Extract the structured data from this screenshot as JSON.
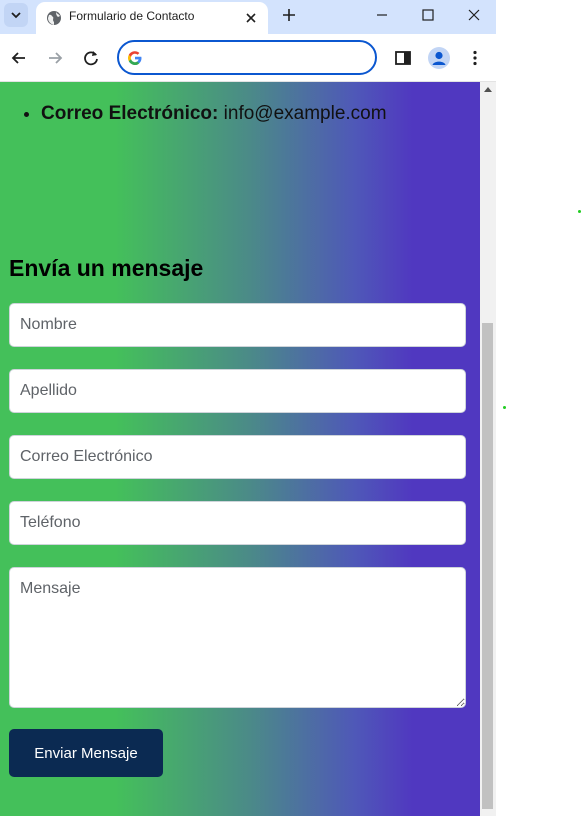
{
  "tab": {
    "title": "Formulario de Contacto",
    "favicon": "globe-icon"
  },
  "toolbar": {
    "address_value": "",
    "search_engine_icon": "google-icon"
  },
  "contact": {
    "email_label": "Correo Electrónico:",
    "email_value": "info@example.com"
  },
  "form": {
    "title": "Envía un mensaje",
    "fields": {
      "first_name": "Nombre",
      "last_name": "Apellido",
      "email": "Correo Electrónico",
      "phone": "Teléfono",
      "message": "Mensaje"
    },
    "submit_label": "Enviar Mensaje"
  },
  "colors": {
    "gradient_start": "#44c05a",
    "gradient_end": "#5038c0",
    "button_bg": "#0b2a52",
    "tabstrip_bg": "#d3e3fd",
    "omnibox_border": "#0b57d0"
  }
}
